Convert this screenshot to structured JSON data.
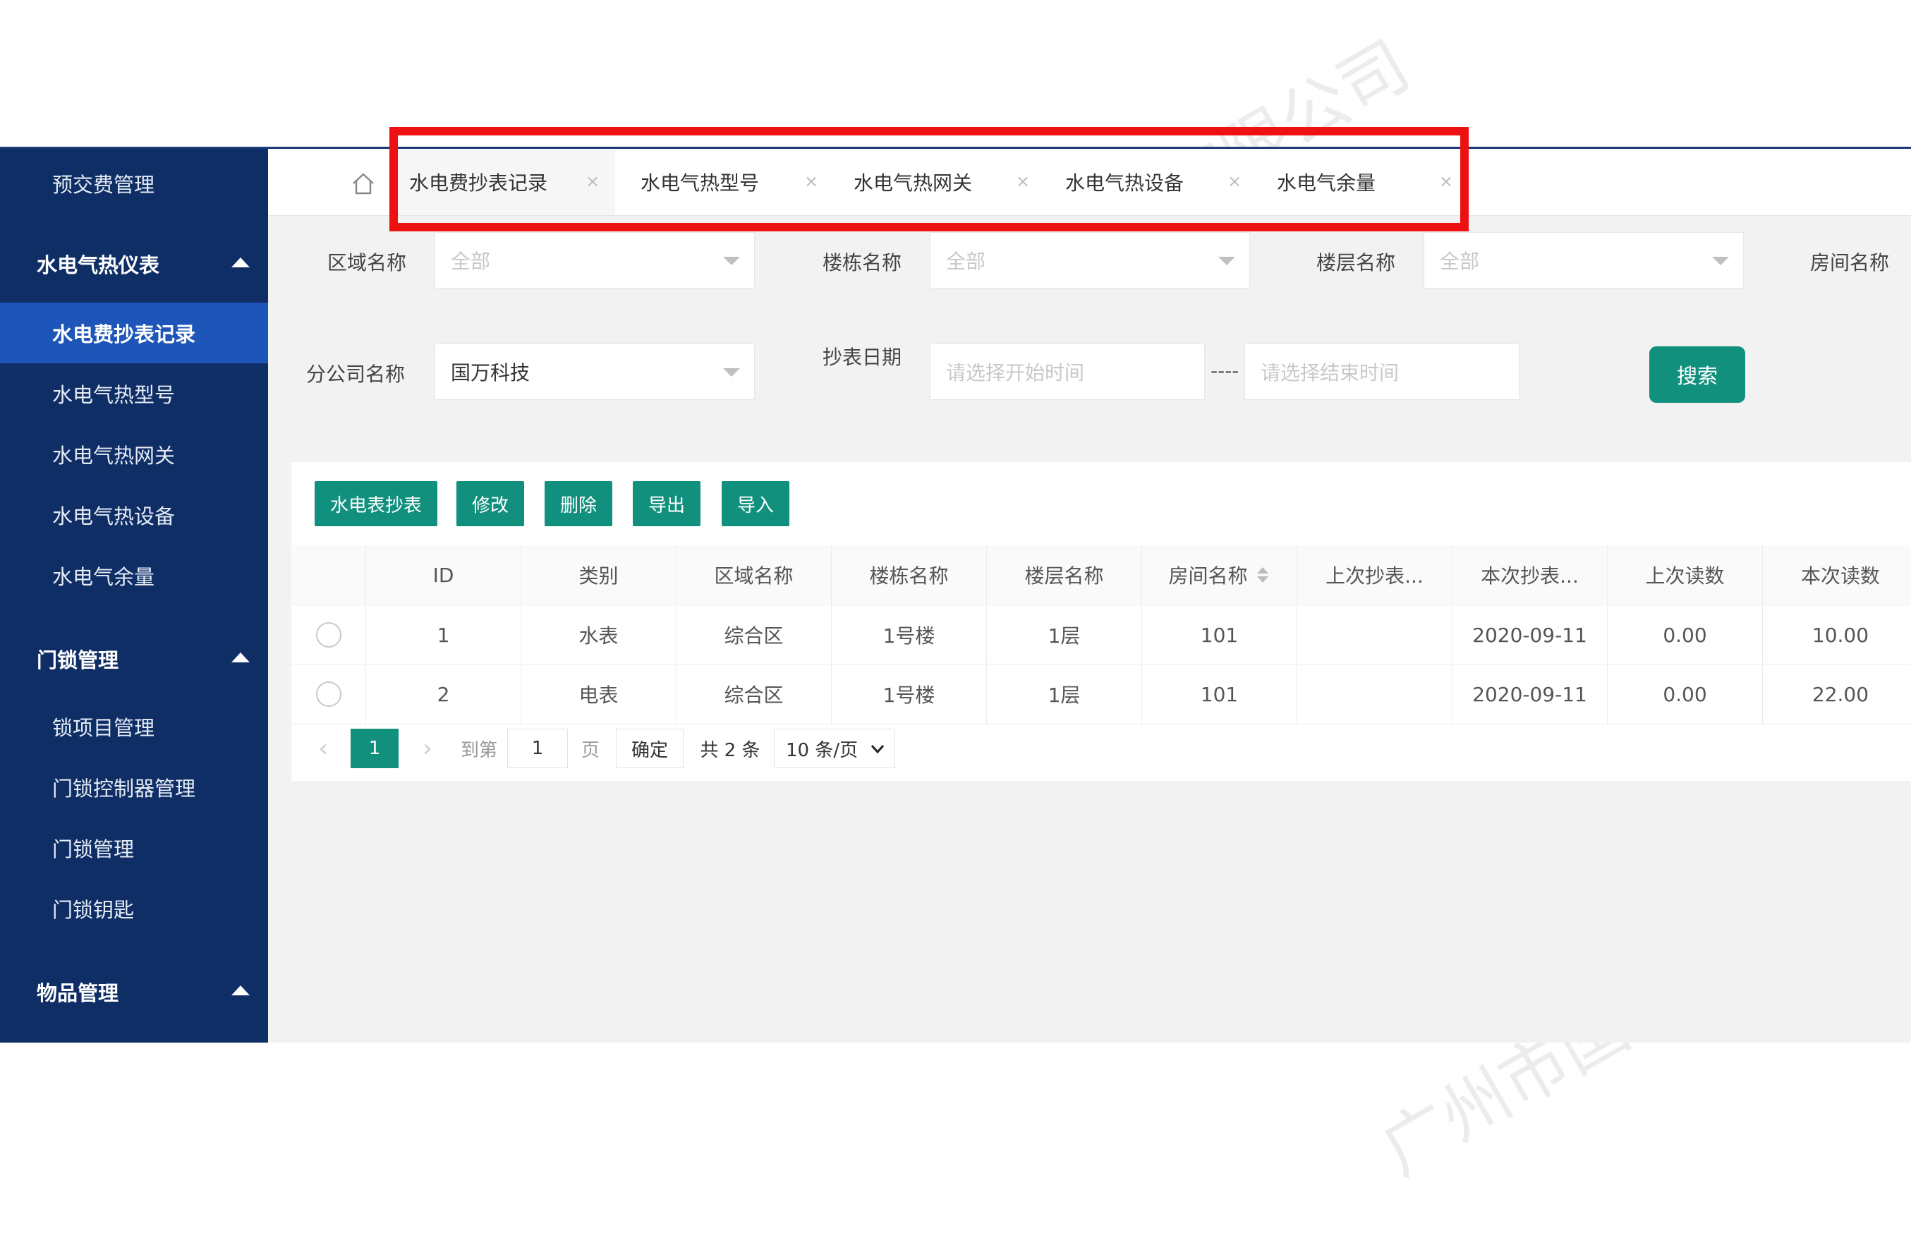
{
  "sidebar": {
    "items": [
      {
        "label": "预交费管理",
        "kind": "sub"
      },
      {
        "label": "水电气热仪表",
        "kind": "group"
      },
      {
        "label": "水电费抄表记录",
        "kind": "active"
      },
      {
        "label": "水电气热型号",
        "kind": "sub"
      },
      {
        "label": "水电气热网关",
        "kind": "sub"
      },
      {
        "label": "水电气热设备",
        "kind": "sub"
      },
      {
        "label": "水电气余量",
        "kind": "sub"
      },
      {
        "label": "门锁管理",
        "kind": "group"
      },
      {
        "label": "锁项目管理",
        "kind": "sub"
      },
      {
        "label": "门锁控制器管理",
        "kind": "sub"
      },
      {
        "label": "门锁管理",
        "kind": "sub"
      },
      {
        "label": "门锁钥匙",
        "kind": "sub"
      },
      {
        "label": "物品管理",
        "kind": "group"
      }
    ]
  },
  "tabs": [
    {
      "label": "水电费抄表记录",
      "active": true
    },
    {
      "label": "水电气热型号"
    },
    {
      "label": "水电气热网关"
    },
    {
      "label": "水电气热设备"
    },
    {
      "label": "水电气余量"
    }
  ],
  "tab_close_glyph": "×",
  "filters": {
    "area_label": "区域名称",
    "area_value": "全部",
    "building_label": "楼栋名称",
    "building_value": "全部",
    "floor_label": "楼层名称",
    "floor_value": "全部",
    "room_label": "房间名称",
    "branch_label": "分公司名称",
    "branch_value": "国万科技",
    "date_label": "抄表日期",
    "date_start_placeholder": "请选择开始时间",
    "date_separator": "----",
    "date_end_placeholder": "请选择结束时间",
    "search_label": "搜索"
  },
  "toolbar": {
    "read_label": "水电表抄表",
    "edit_label": "修改",
    "delete_label": "删除",
    "export_label": "导出",
    "import_label": "导入"
  },
  "table": {
    "columns": [
      "ID",
      "类别",
      "区域名称",
      "楼栋名称",
      "楼层名称",
      "房间名称",
      "上次抄表...",
      "本次抄表...",
      "上次读数",
      "本次读数"
    ],
    "rows": [
      [
        "1",
        "水表",
        "综合区",
        "1号楼",
        "1层",
        "101",
        "",
        "2020-09-11",
        "0.00",
        "10.00"
      ],
      [
        "2",
        "电表",
        "综合区",
        "1号楼",
        "1层",
        "101",
        "",
        "2020-09-11",
        "0.00",
        "22.00"
      ]
    ]
  },
  "pagination": {
    "prev": "‹",
    "current": "1",
    "next": "›",
    "goto_label": "到第",
    "page_input": "1",
    "page_unit": "页",
    "confirm_label": "确定",
    "total_label": "共 2 条",
    "page_size": "10 条/页"
  },
  "watermark": [
    "广州市国万电子科技有限公司"
  ]
}
